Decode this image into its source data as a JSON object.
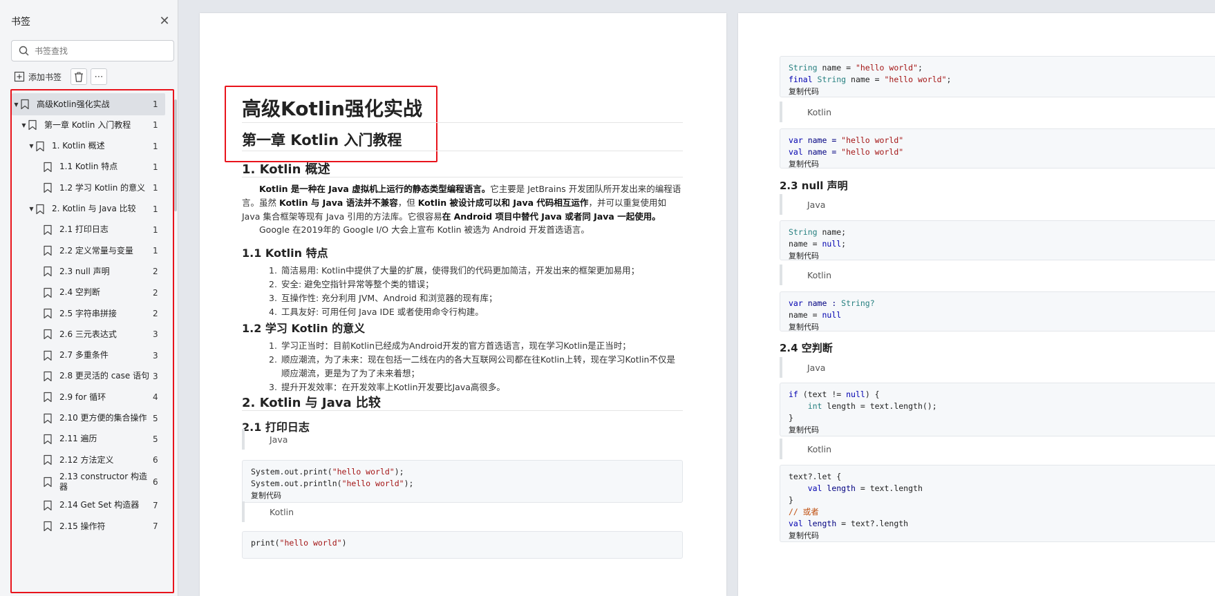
{
  "sidebar": {
    "title": "书签",
    "search_placeholder": "书签查找",
    "add_bookmark": "添加书签",
    "items": [
      {
        "label": "高级Kotlin强化实战",
        "page": "1"
      },
      {
        "label": "第一章 Kotlin 入门教程",
        "page": "1"
      },
      {
        "label": "1. Kotlin 概述",
        "page": "1"
      },
      {
        "label": "1.1 Kotlin 特点",
        "page": "1"
      },
      {
        "label": "1.2 学习 Kotlin 的意义",
        "page": "1"
      },
      {
        "label": "2. Kotlin 与 Java 比较",
        "page": "1"
      },
      {
        "label": "2.1 打印日志",
        "page": "1"
      },
      {
        "label": "2.2 定义常量与变量",
        "page": "1"
      },
      {
        "label": "2.3 null 声明",
        "page": "2"
      },
      {
        "label": "2.4 空判断",
        "page": "2"
      },
      {
        "label": "2.5 字符串拼接",
        "page": "2"
      },
      {
        "label": "2.6 三元表达式",
        "page": "3"
      },
      {
        "label": "2.7 多重条件",
        "page": "3"
      },
      {
        "label": "2.8 更灵活的 case 语句",
        "page": "3"
      },
      {
        "label": "2.9 for 循环",
        "page": "4"
      },
      {
        "label": "2.10 更方便的集合操作",
        "page": "5"
      },
      {
        "label": "2.11 遍历",
        "page": "5"
      },
      {
        "label": "2.12 方法定义",
        "page": "6"
      },
      {
        "label": "2.13 constructor 构造器",
        "page": "6"
      },
      {
        "label": "2.14 Get Set 构造器",
        "page": "7"
      },
      {
        "label": "2.15 操作符",
        "page": "7"
      }
    ]
  },
  "page1": {
    "title": "高级Kotlin强化实战",
    "chapter": "第一章 Kotlin 入门教程",
    "s1": "1. Kotlin 概述",
    "p1_b1": "Kotlin 是一种在 Java 虚拟机上运行的静态类型编程语言。",
    "p1_t1": "它主要是 JetBrains 开发团队所开发出来的编程语言。虽然 ",
    "p1_b2": "Kotlin 与 Java 语法并不兼容",
    "p1_t2": "，但 ",
    "p1_b3": "Kotlin 被设计成可以和 Java 代码相互运作",
    "p1_t3": "，并可以重复使用如 Java 集合框架等现有 Java 引用的方法库。它很容易",
    "p1_b4": "在 Android 项目中替代 Java 或者同 Java 一起使用。",
    "p2": "Google 在2019年的 Google I/O 大会上宣布 Kotlin 被选为 Android 开发首选语言。",
    "s11": "1.1 Kotlin 特点",
    "features": [
      "简洁易用: Kotlin中提供了大量的扩展，使得我们的代码更加简洁，开发出来的框架更加易用；",
      "安全: 避免空指针异常等整个类的错误；",
      "互操作性: 充分利用 JVM、Android 和浏览器的现有库；",
      "工具友好: 可用任何 Java IDE 或者使用命令行构建。"
    ],
    "s12": "1.2 学习 Kotlin 的意义",
    "meanings": [
      "学习正当时：目前Kotlin已经成为Android开发的官方首选语言，现在学习Kotlin是正当时；",
      "顺应潮流，为了未来：现在包括一二线在内的各大互联网公司都在往Kotlin上转，现在学习Kotlin不仅是顺应潮流，更是为了为了未来着想；",
      "提升开发效率：在开发效率上Kotlin开发要比Java高很多。"
    ],
    "s2": "2. Kotlin 与 Java 比较",
    "s21": "2.1 打印日志",
    "java": "Java",
    "kotlin": "Kotlin",
    "copy": "复制代码",
    "code_java_1": "System.out.print(",
    "code_java_1s": "\"hello world\"",
    "code_java_2": "System.out.println(",
    "code_java_2s": "\"hello world\"",
    "code_end": ");",
    "code_kt_1": "print(",
    "code_kt_1s": "\"hello world\"",
    "code_kt_end": ")"
  },
  "page2": {
    "c1_l1a": "String",
    "c1_l1b": " name = ",
    "c1_l1c": "\"hello world\"",
    "c1_l2a": "final",
    "c1_l2b": " String",
    "c1_l2c": " name = ",
    "c1_l2d": "\"hello world\"",
    "kotlin": "Kotlin",
    "java": "Java",
    "copy": "复制代码",
    "c2_var": "var",
    "c2_name": " name = ",
    "c2_s": "\"hello world\"",
    "c2_val": "val",
    "s23": "2.3 null 声明",
    "c3_l1a": "String",
    "c3_l1b": " name;",
    "c3_l2a": "name = ",
    "c3_l2b": "null",
    "c4_l1a": "var",
    "c4_l1b": " name : ",
    "c4_l1c": "String?",
    "c4_l2a": "name = ",
    "c4_l2b": "null",
    "s24": "2.4 空判断",
    "c5_l1a": "if",
    "c5_l1b": " (text != ",
    "c5_l1c": "null",
    "c5_l1d": ") {",
    "c5_l2a": "    int",
    "c5_l2b": " length = text.length();",
    "c5_l3": "}",
    "c6_l1": "text?.let {",
    "c6_l2a": "    val",
    "c6_l2b": " length",
    "c6_l2c": " = text.length",
    "c6_l3": "}",
    "c6_l4": "// 或者",
    "c6_l5a": "val",
    "c6_l5b": " length",
    "c6_l5c": " = text?.length"
  }
}
